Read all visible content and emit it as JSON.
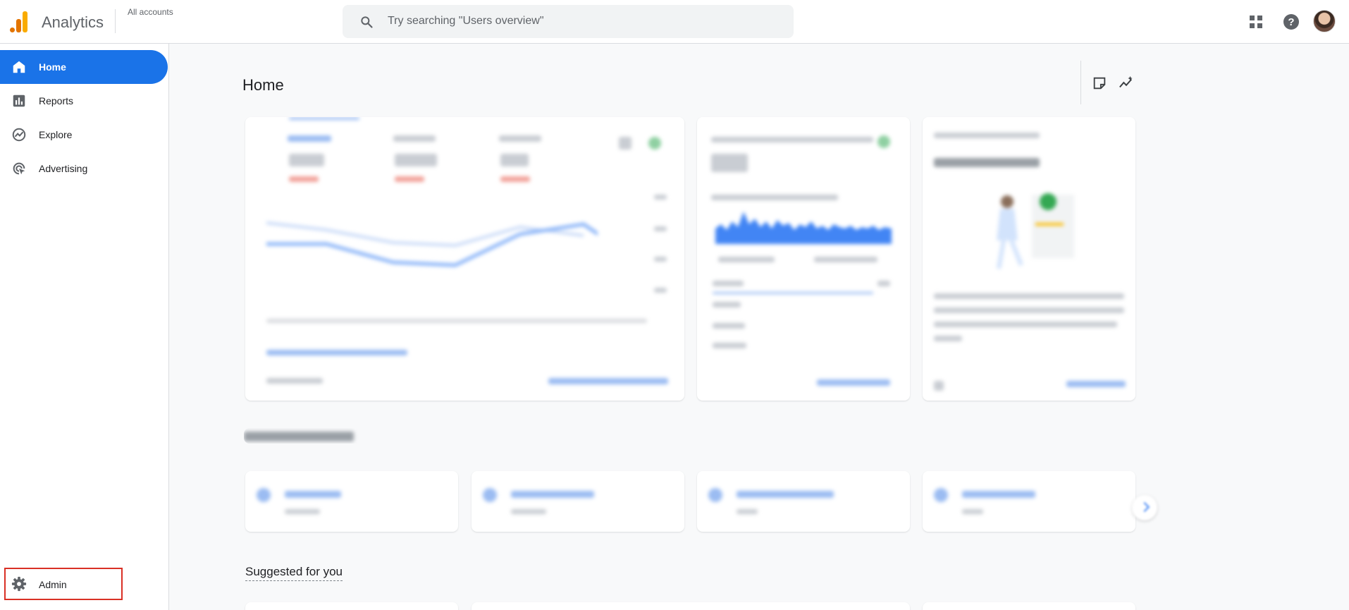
{
  "header": {
    "brand": "Analytics",
    "account_label": "All accounts",
    "search_placeholder": "Try searching \"Users overview\"",
    "icons": [
      "apps-grid-icon",
      "help-icon",
      "avatar"
    ]
  },
  "sidebar": {
    "items": [
      {
        "label": "Home",
        "icon": "home-icon",
        "active": true
      },
      {
        "label": "Reports",
        "icon": "bar-chart-icon",
        "active": false
      },
      {
        "label": "Explore",
        "icon": "explore-icon",
        "active": false
      },
      {
        "label": "Advertising",
        "icon": "advertising-icon",
        "active": false
      }
    ],
    "admin": {
      "label": "Admin",
      "icon": "gear-icon"
    }
  },
  "main": {
    "title": "Home",
    "suggested_title": "Suggested for you"
  },
  "colors": {
    "accent": "#1a73e8",
    "highlight_border": "#d93025",
    "logo_orange": "#e37400",
    "logo_yellow": "#f9ab00"
  }
}
